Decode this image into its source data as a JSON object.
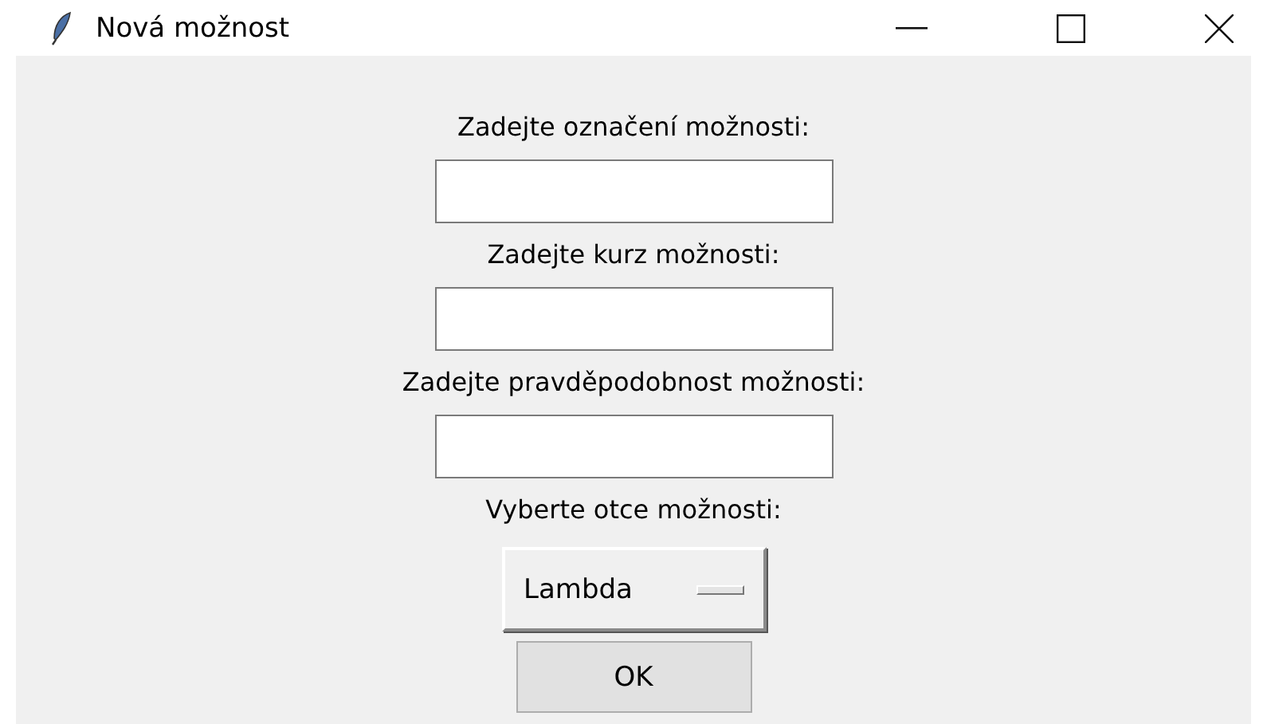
{
  "window": {
    "title": "Nová možnost"
  },
  "form": [
    {
      "kind": "entry",
      "label": "Zadejte označení možnosti:"
    },
    {
      "kind": "entry",
      "label": "Zadejte kurz možnosti:"
    },
    {
      "kind": "entry",
      "label": "Zadejte pravděpodobnost možnosti:"
    },
    {
      "kind": "option_menu",
      "label": "Vyberte otce možnosti:",
      "value": "Lambda"
    }
  ],
  "buttons": [
    "OK"
  ]
}
